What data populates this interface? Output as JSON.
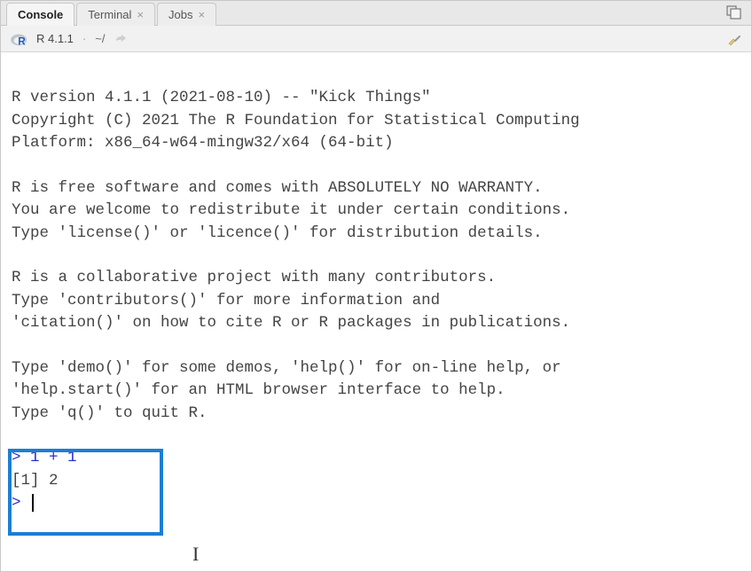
{
  "tabs": [
    {
      "label": "Console",
      "closable": false,
      "active": true
    },
    {
      "label": "Terminal",
      "closable": true,
      "active": false
    },
    {
      "label": "Jobs",
      "closable": true,
      "active": false
    }
  ],
  "info": {
    "r_version": "R 4.1.1",
    "working_dir": "~/"
  },
  "console": {
    "startup_text": "R version 4.1.1 (2021-08-10) -- \"Kick Things\"\nCopyright (C) 2021 The R Foundation for Statistical Computing\nPlatform: x86_64-w64-mingw32/x64 (64-bit)\n\nR is free software and comes with ABSOLUTELY NO WARRANTY.\nYou are welcome to redistribute it under certain conditions.\nType 'license()' or 'licence()' for distribution details.\n\nR is a collaborative project with many contributors.\nType 'contributors()' for more information and\n'citation()' on how to cite R or R packages in publications.\n\nType 'demo()' for some demos, 'help()' for on-line help, or\n'help.start()' for an HTML browser interface to help.\nType 'q()' to quit R.\n",
    "history": [
      {
        "prompt": ">",
        "input": "1 + 1",
        "output": "[1] 2"
      }
    ],
    "current_prompt": ">"
  },
  "icons": {
    "window_control": "maximize-pane-icon",
    "r_logo": "r-logo-icon",
    "share": "share-arrow-icon",
    "clear": "clear-console-icon"
  }
}
